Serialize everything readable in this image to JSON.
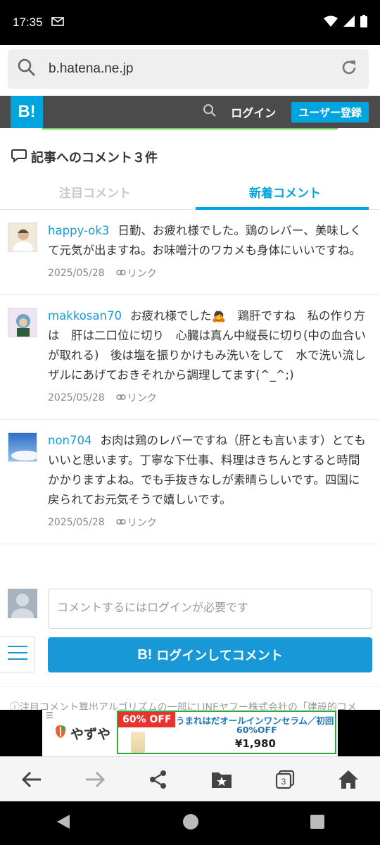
{
  "status": {
    "time": "17:35"
  },
  "browser": {
    "url": "b.hatena.ne.jp"
  },
  "header": {
    "login": "ログイン",
    "register": "ユーザー登録"
  },
  "section": {
    "title": "記事へのコメント３件"
  },
  "tabs": {
    "featured": "注目コメント",
    "recent": "新着コメント"
  },
  "comments": [
    {
      "user": "happy-ok3",
      "text": "日勤、お疲れ様でした。鶏のレバー、美味しくて元気が出ますね。お味噌汁のワカメも身体にいいですね。",
      "date": "2025/05/28",
      "link": "リンク"
    },
    {
      "user": "makkosan70",
      "text": "お疲れ様でした🙇　鶏肝ですね　私の作り方は　肝は二口位に切り　心臓は真ん中縦長に切り(中の血合いが取れる)　後は塩を振りかけもみ洗いをして　水で洗い流し　ザルにあげておきそれから調理してます(^_^;)",
      "date": "2025/05/28",
      "link": "リンク"
    },
    {
      "user": "non704",
      "text": "お肉は鶏のレバーですね（肝とも言います）とてもいいと思います。丁寧な下仕事、料理はきちんとすると時間かかりますよね。でも手抜きなしが素晴らしいです。四国に戻られてお元気そうで嬉しいです。",
      "date": "2025/05/28",
      "link": "リンク"
    }
  ],
  "form": {
    "placeholder": "コメントするにはログインが必要です",
    "button": "ログインしてコメント",
    "logo": "B!"
  },
  "footnote": "ⓘ注目コメント算出アルゴリズムの一部にLINEヤフー株式会社の「建設的コメ",
  "ad": {
    "brand": "やずや",
    "badge": "60% OFF",
    "line1": "うまれはだオールインワンセラム／初回",
    "line2": "60%OFF",
    "price": "¥1,980"
  },
  "tabs_count": "3",
  "colors": {
    "accent": "#00a4de",
    "header_bg": "#4b4b4b",
    "link": "#1b9ad6"
  }
}
